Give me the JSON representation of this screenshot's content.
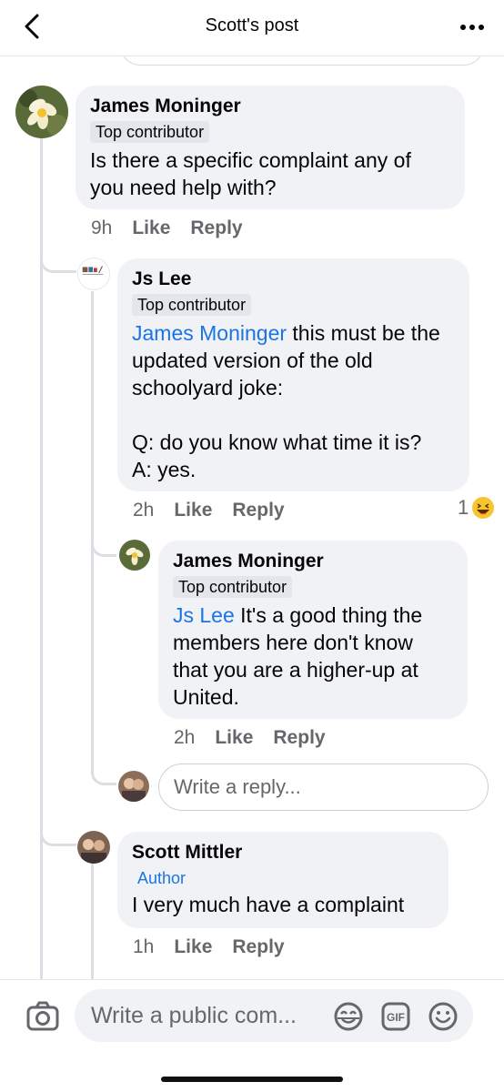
{
  "header": {
    "title": "Scott's post"
  },
  "comments": [
    {
      "name": "James Moninger",
      "badge": "Top contributor",
      "text": "Is there a specific complaint any of you need help with?",
      "time": "9h",
      "like": "Like",
      "reply": "Reply"
    },
    {
      "name": "Js Lee",
      "badge": "Top contributor",
      "mention": "James Moninger",
      "text": " this must be the updated version of the old schoolyard joke:\n\nQ: do you know what time it is?\nA: yes.",
      "time": "2h",
      "like": "Like",
      "reply": "Reply",
      "reaction_count": "1"
    },
    {
      "name": "James Moninger",
      "badge": "Top contributor",
      "mention": "Js Lee",
      "text": " It's a good thing the members here don't know that you are a higher-up at United.",
      "time": "2h",
      "like": "Like",
      "reply": "Reply"
    },
    {
      "name": "Scott Mittler",
      "badge": "Author",
      "text": "I very much have a complaint",
      "time": "1h",
      "like": "Like",
      "reply": "Reply"
    }
  ],
  "reply_box": {
    "placeholder": "Write a reply..."
  },
  "footer": {
    "placeholder": "Write a public com..."
  },
  "colors": {
    "link": "#1b74e4",
    "bubble": "#f0f2f5",
    "meta": "#65676b"
  }
}
